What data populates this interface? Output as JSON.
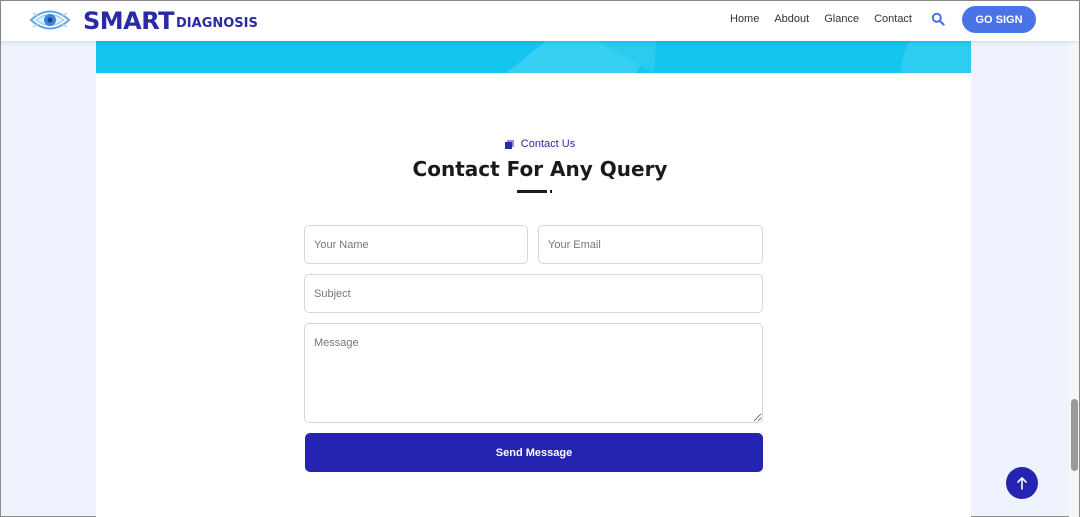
{
  "header": {
    "brand_big": "SMART",
    "brand_small": "DIAGNOSIS",
    "logo_icon": "eye-icon",
    "nav": [
      {
        "label": "Home"
      },
      {
        "label": "Abdout"
      },
      {
        "label": "Glance"
      },
      {
        "label": "Contact"
      }
    ],
    "search_icon": "search-icon",
    "cta_label": "GO SIGN"
  },
  "contact": {
    "tag": "Contact Us",
    "tag_icon": "square-icon",
    "title": "Contact For Any Query",
    "name_placeholder": "Your Name",
    "email_placeholder": "Your Email",
    "subject_placeholder": "Subject",
    "message_placeholder": "Message",
    "submit_label": "Send Message"
  },
  "back_to_top_icon": "arrow-up-icon",
  "colors": {
    "brand": "#2b2aa6",
    "accent": "#4a73e8",
    "button": "#2424b0",
    "hero": "#12c6ee",
    "page_bg": "#eef3fd"
  }
}
